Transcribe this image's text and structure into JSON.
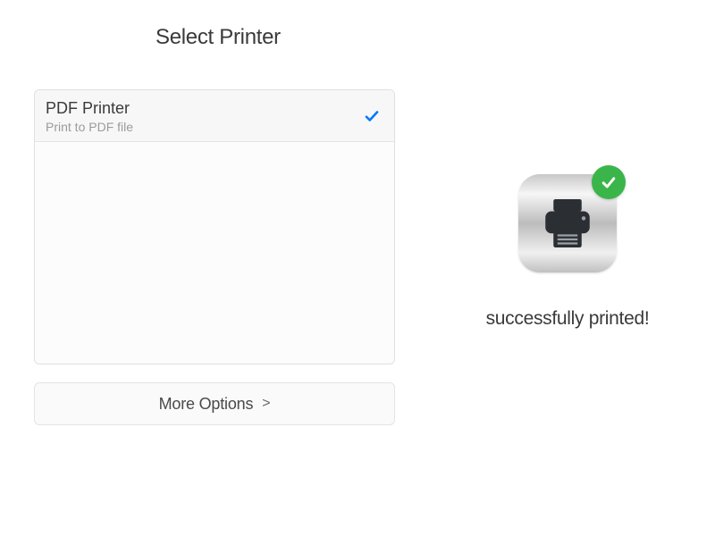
{
  "title": "Select Printer",
  "printers": [
    {
      "name": "PDF Printer",
      "description": "Print to PDF file",
      "selected": true
    }
  ],
  "more_options_label": "More Options",
  "success_message": "successfully printed!"
}
